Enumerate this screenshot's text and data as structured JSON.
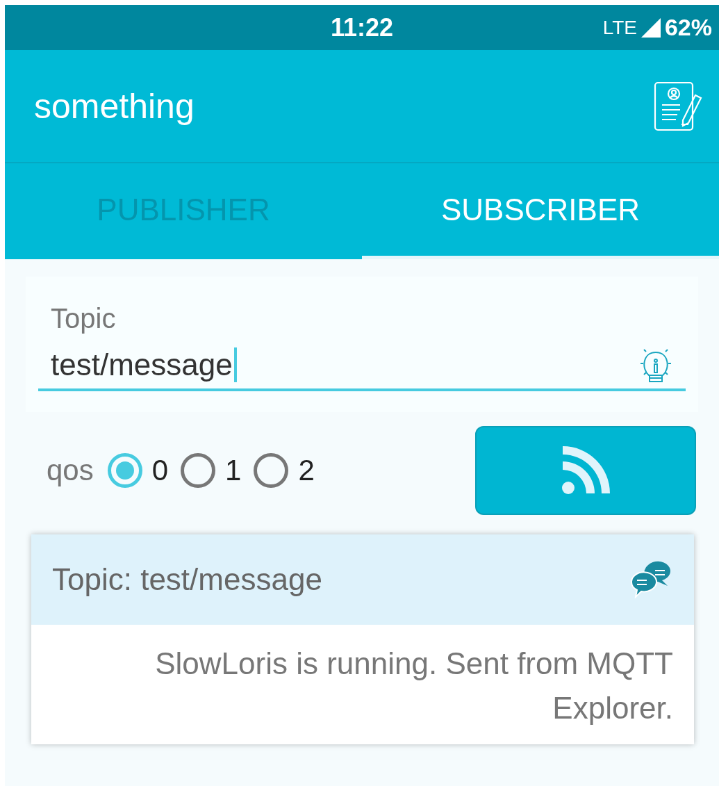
{
  "status_bar": {
    "time": "11:22",
    "network": "LTE",
    "battery": "62%"
  },
  "app_bar": {
    "title": "something"
  },
  "tabs": [
    {
      "label": "PUBLISHER",
      "selected": false
    },
    {
      "label": "SUBSCRIBER",
      "selected": true
    }
  ],
  "topic_field": {
    "label": "Topic",
    "value": "test/message"
  },
  "qos": {
    "label": "qos",
    "options": [
      {
        "label": "0",
        "selected": true
      },
      {
        "label": "1",
        "selected": false
      },
      {
        "label": "2",
        "selected": false
      }
    ]
  },
  "message_card": {
    "title": "Topic: test/message",
    "body": "SlowLoris is running. Sent from MQTT Explorer."
  }
}
